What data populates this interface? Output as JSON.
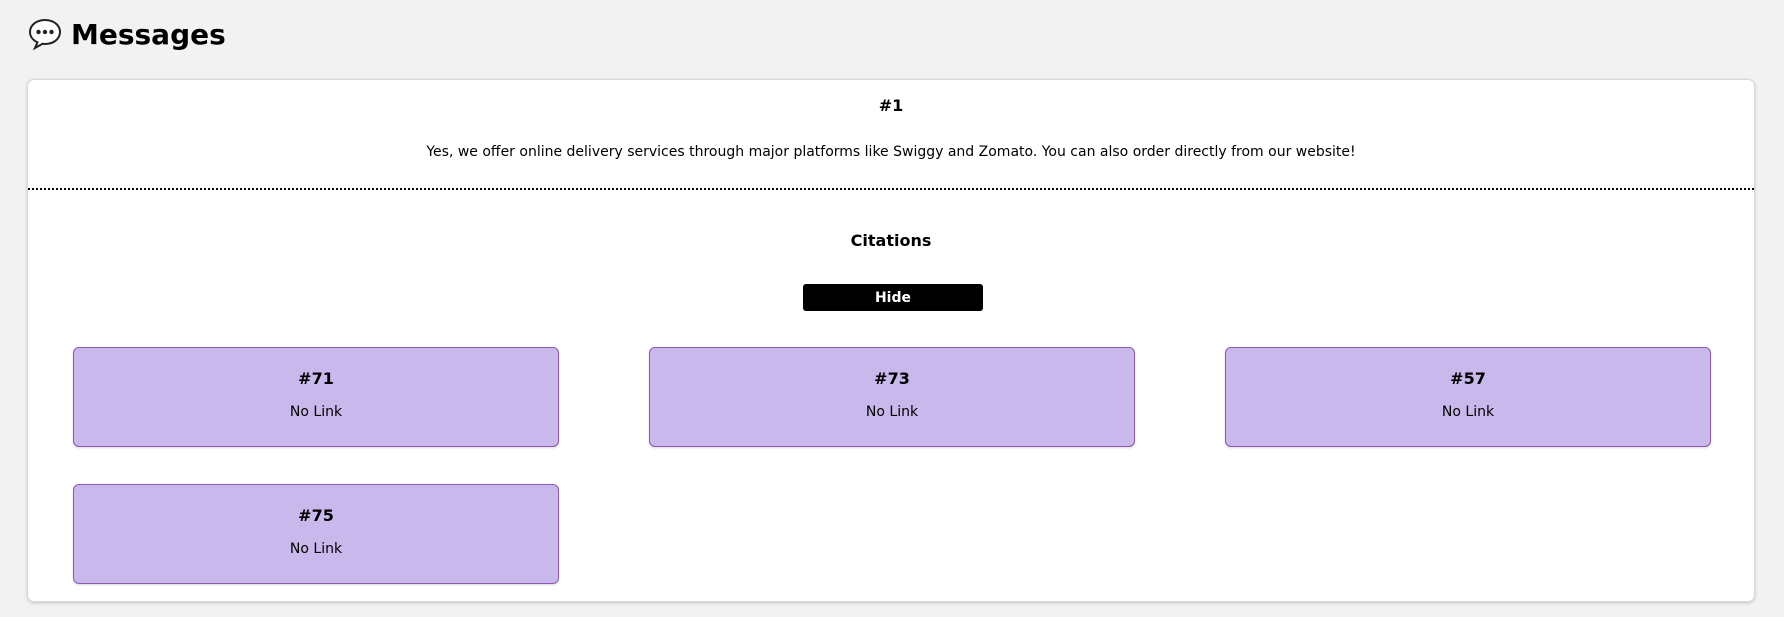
{
  "header": {
    "icon": "speech-bubble-icon",
    "title": "Messages"
  },
  "message": {
    "number": "#1",
    "text": "Yes, we offer online delivery services through major platforms like Swiggy and Zomato. You can also order directly from our website!"
  },
  "citations": {
    "title": "Citations",
    "toggle_label": "Hide",
    "items": [
      {
        "number": "#71",
        "link": "No Link"
      },
      {
        "number": "#73",
        "link": "No Link"
      },
      {
        "number": "#57",
        "link": "No Link"
      },
      {
        "number": "#75",
        "link": "No Link"
      }
    ]
  },
  "colors": {
    "page_background": "#f2f2f2",
    "card_background": "#ffffff",
    "citation_background": "#c9b8ec",
    "citation_border": "#8e5ab5",
    "button_background": "#000000",
    "button_text": "#ffffff"
  }
}
